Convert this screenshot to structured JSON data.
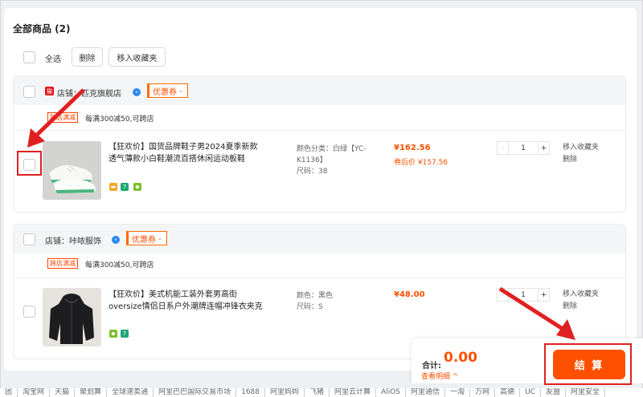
{
  "header": {
    "title": "全部商品 (2)"
  },
  "toolbar": {
    "select_all": "全选",
    "delete": "删除",
    "move_fav": "移入收藏夹"
  },
  "shops": [
    {
      "name": "店铺：匹克旗舰店",
      "coupon": "优惠券",
      "promo_badge": "跨店满减",
      "promo_text": "每满300减50,可跨店",
      "item": {
        "title_line1": "【狂欢价】国货品牌鞋子男2024夏季新款",
        "title_line2": "透气薄款小白鞋潮流百搭休闲运动板鞋",
        "attr_line1": "颜色分类：白绿【YC-",
        "attr_line2": "K1136】",
        "attr_line3": "尺码：38",
        "price": "¥162.56",
        "price_after": "券后价 ¥157.56",
        "qty": "1",
        "fav": "移入收藏夹",
        "delete": "删除"
      }
    },
    {
      "name": "店铺：咔哝服饰",
      "coupon": "优惠券",
      "promo_badge": "跨店满减",
      "promo_text": "每满300减50,可跨店",
      "item": {
        "title_line1": "【狂欢价】美式机能工装外套男高街",
        "title_line2": "oversize情侣日系户外潮牌连帽冲锋衣夹克",
        "attr_line1": "颜色：黑色",
        "attr_line2": "尺码：S",
        "price": "¥48.00",
        "qty": "1",
        "fav": "移入收藏夹",
        "delete": "删除"
      }
    }
  ],
  "summary": {
    "total_label": "合计:",
    "total_value": "0.00",
    "detail": "查看明细 ^",
    "checkout": "结 算"
  },
  "footer": [
    "团",
    "淘宝网",
    "天猫",
    "聚划算",
    "全球速卖通",
    "阿里巴巴国际交易市场",
    "1688",
    "阿里妈妈",
    "飞猪",
    "阿里云计算",
    "AliOS",
    "阿里通信",
    "一淘",
    "万网",
    "高德",
    "UC",
    "友盟",
    "阿里安全"
  ],
  "colors": {
    "accent": "#ff5000",
    "highlight": "#e02020"
  }
}
